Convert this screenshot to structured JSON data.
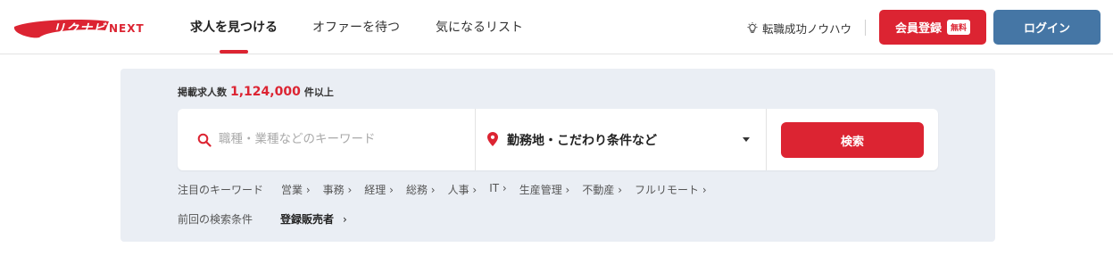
{
  "brand": {
    "logo_text": "リクナビ",
    "logo_sub": "NEXT",
    "accent": "#dc2432",
    "login_color": "#4576a5"
  },
  "nav": {
    "items": [
      {
        "label": "求人を見つける",
        "active": true
      },
      {
        "label": "オファーを待つ",
        "active": false
      },
      {
        "label": "気になるリスト",
        "active": false
      }
    ]
  },
  "header_right": {
    "knowhow": "転職成功ノウハウ",
    "knowhow_icon": "lightbulb-icon",
    "register_label": "会員登録",
    "register_badge": "無料",
    "login_label": "ログイン"
  },
  "search": {
    "count_prefix": "掲載求人数",
    "count_value": "1,124,000",
    "count_suffix": "件以上",
    "keyword_placeholder": "職種・業種などのキーワード",
    "keyword_icon": "search-icon",
    "location_label": "勤務地・こだわり条件など",
    "location_icon": "map-pin-icon",
    "search_button": "検索"
  },
  "keywords": {
    "title": "注目のキーワード",
    "items": [
      "営業",
      "事務",
      "経理",
      "総務",
      "人事",
      "IT",
      "生産管理",
      "不動産",
      "フルリモート"
    ]
  },
  "previous": {
    "title": "前回の検索条件",
    "value": "登録販売者",
    "chevron": "›"
  }
}
